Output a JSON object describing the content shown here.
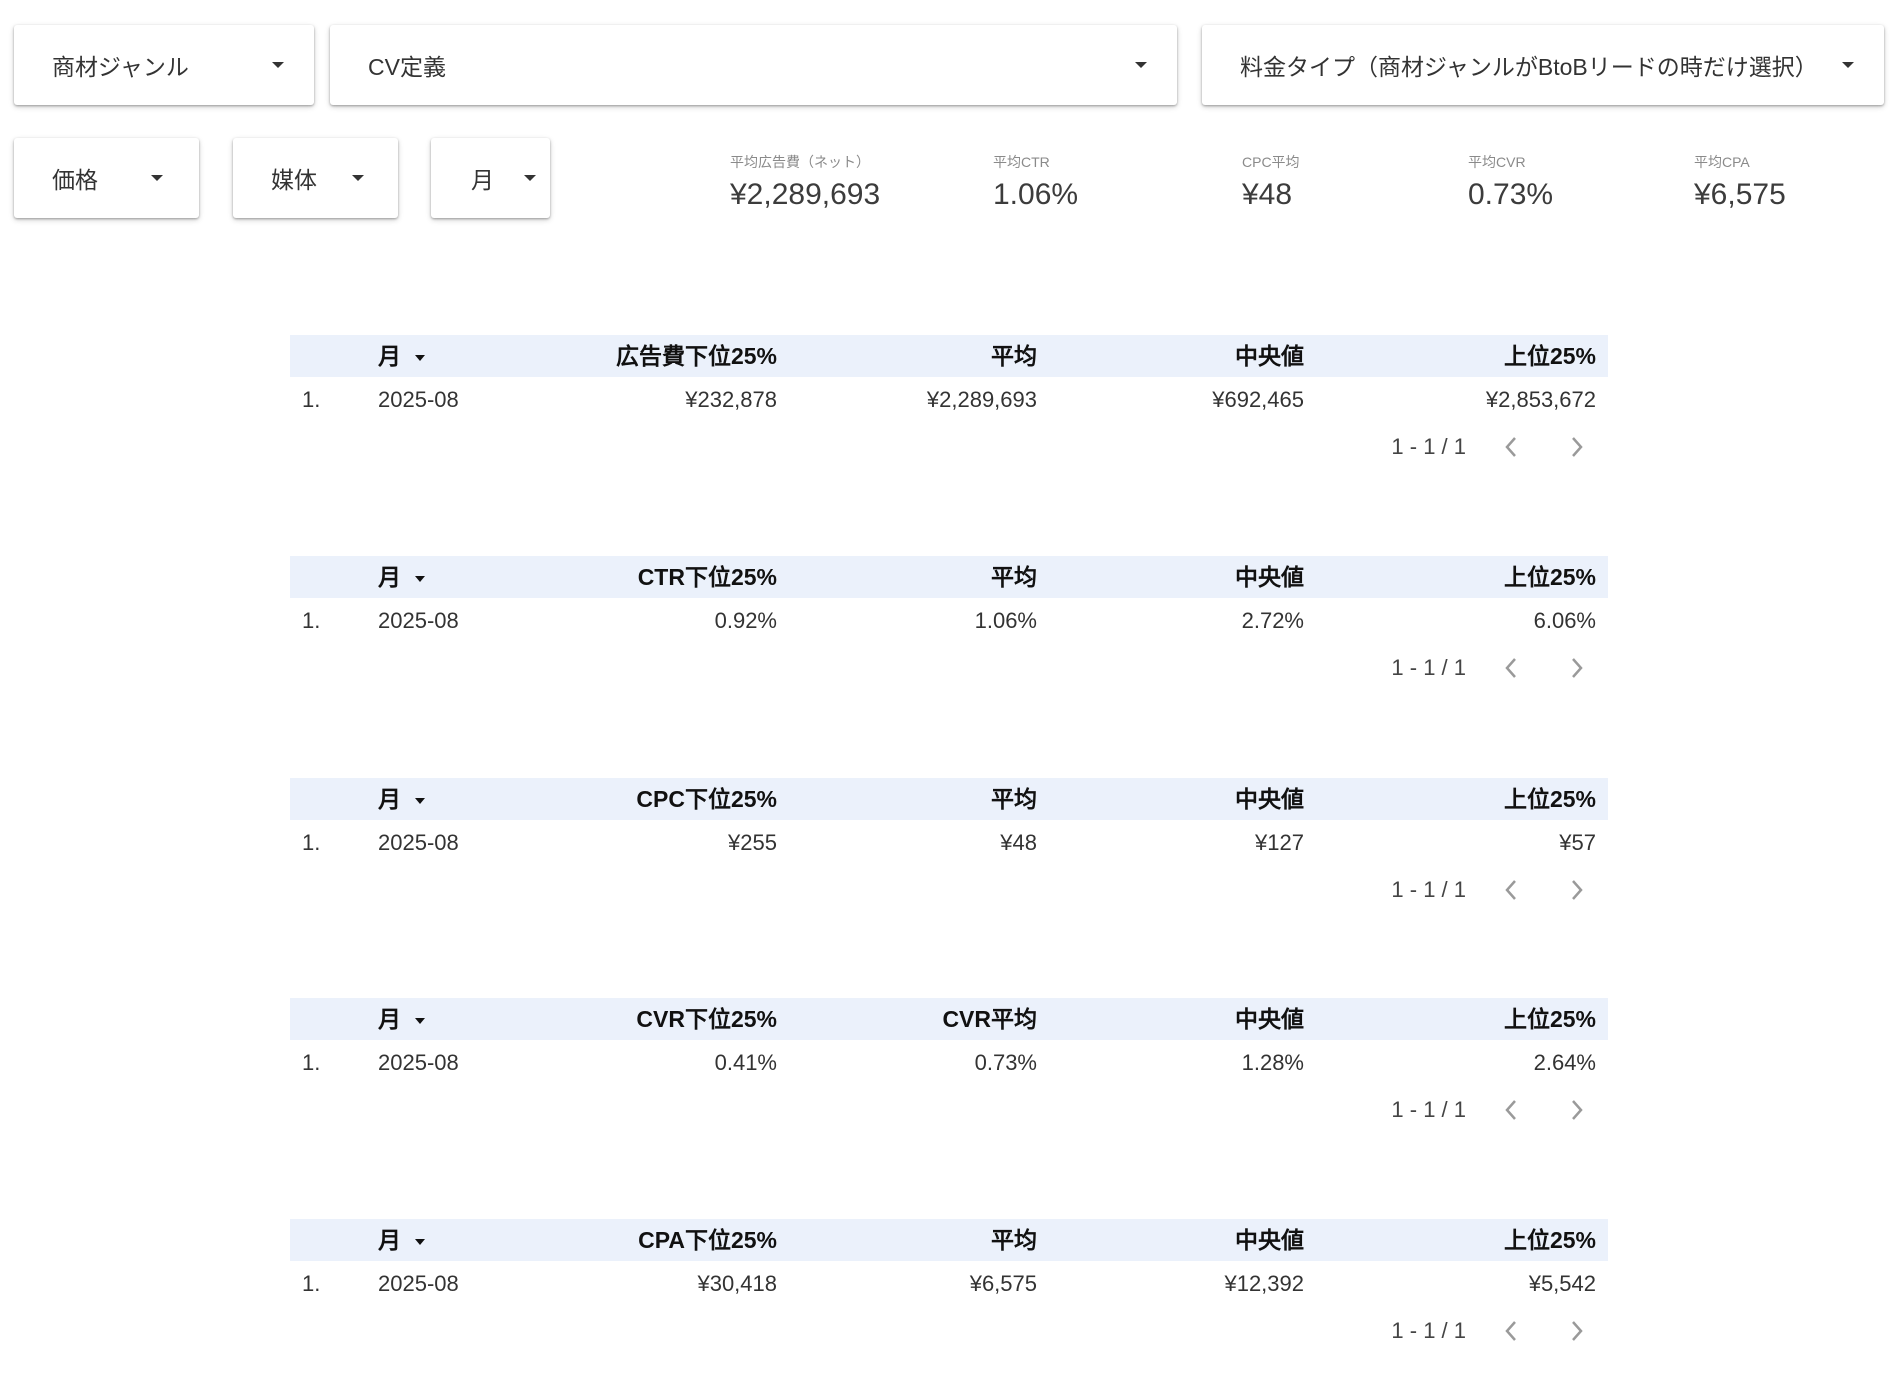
{
  "filters": {
    "genre": "商材ジャンル",
    "cv": "CV定義",
    "pricing": "料金タイプ（商材ジャンルがBtoBリードの時だけ選択）",
    "price": "価格",
    "media": "媒体",
    "month": "月"
  },
  "kpis": [
    {
      "label": "平均広告費（ネット）",
      "value": "¥2,289,693"
    },
    {
      "label": "平均CTR",
      "value": "1.06%"
    },
    {
      "label": "CPC平均",
      "value": "¥48"
    },
    {
      "label": "平均CVR",
      "value": "0.73%"
    },
    {
      "label": "平均CPA",
      "value": "¥6,575"
    }
  ],
  "tables": [
    {
      "headers": [
        "月",
        "広告費下位25%",
        "平均",
        "中央値",
        "上位25%"
      ],
      "row": [
        "1.",
        "2025-08",
        "¥232,878",
        "¥2,289,693",
        "¥692,465",
        "¥2,853,672"
      ],
      "pagination": "1 - 1 / 1"
    },
    {
      "headers": [
        "月",
        "CTR下位25%",
        "平均",
        "中央値",
        "上位25%"
      ],
      "row": [
        "1.",
        "2025-08",
        "0.92%",
        "1.06%",
        "2.72%",
        "6.06%"
      ],
      "pagination": "1 - 1 / 1"
    },
    {
      "headers": [
        "月",
        "CPC下位25%",
        "平均",
        "中央値",
        "上位25%"
      ],
      "row": [
        "1.",
        "2025-08",
        "¥255",
        "¥48",
        "¥127",
        "¥57"
      ],
      "pagination": "1 - 1 / 1"
    },
    {
      "headers": [
        "月",
        "CVR下位25%",
        "CVR平均",
        "中央値",
        "上位25%"
      ],
      "row": [
        "1.",
        "2025-08",
        "0.41%",
        "0.73%",
        "1.28%",
        "2.64%"
      ],
      "pagination": "1 - 1 / 1"
    },
    {
      "headers": [
        "月",
        "CPA下位25%",
        "平均",
        "中央値",
        "上位25%"
      ],
      "row": [
        "1.",
        "2025-08",
        "¥30,418",
        "¥6,575",
        "¥12,392",
        "¥5,542"
      ],
      "pagination": "1 - 1 / 1"
    }
  ],
  "colors": {
    "header_bg": "#ebf1fb",
    "text": "#222222",
    "muted": "#8a8a8a"
  },
  "icons": {
    "dropdown": "caret-down-icon",
    "sort": "sort-caret-icon",
    "prev": "chevron-left-icon",
    "next": "chevron-right-icon"
  }
}
